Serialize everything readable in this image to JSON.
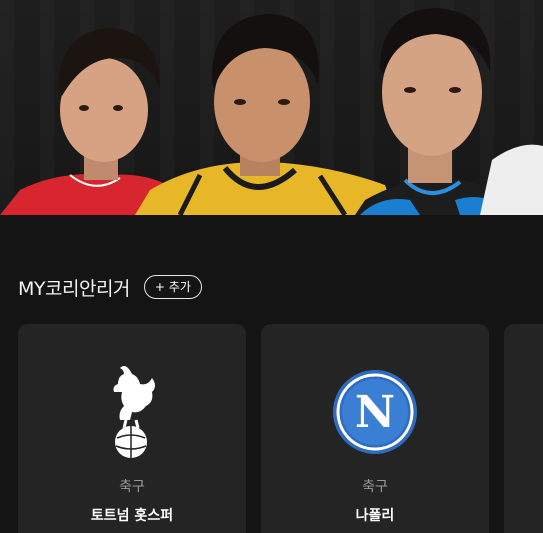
{
  "hero": {
    "image_label": "players-banner"
  },
  "section": {
    "title": "MY코리안리거",
    "add_button_label": "+ 추가"
  },
  "cards": [
    {
      "sport": "축구",
      "team": "토트넘 홋스퍼",
      "logo_icon": "tottenham-crest-icon"
    },
    {
      "sport": "축구",
      "team": "나폴리",
      "logo_icon": "napoli-crest-icon"
    }
  ],
  "colors": {
    "background": "#141414",
    "card_background": "#242424",
    "napoli_blue": "#2f6cc0",
    "muted_text": "#9a9a9a"
  }
}
